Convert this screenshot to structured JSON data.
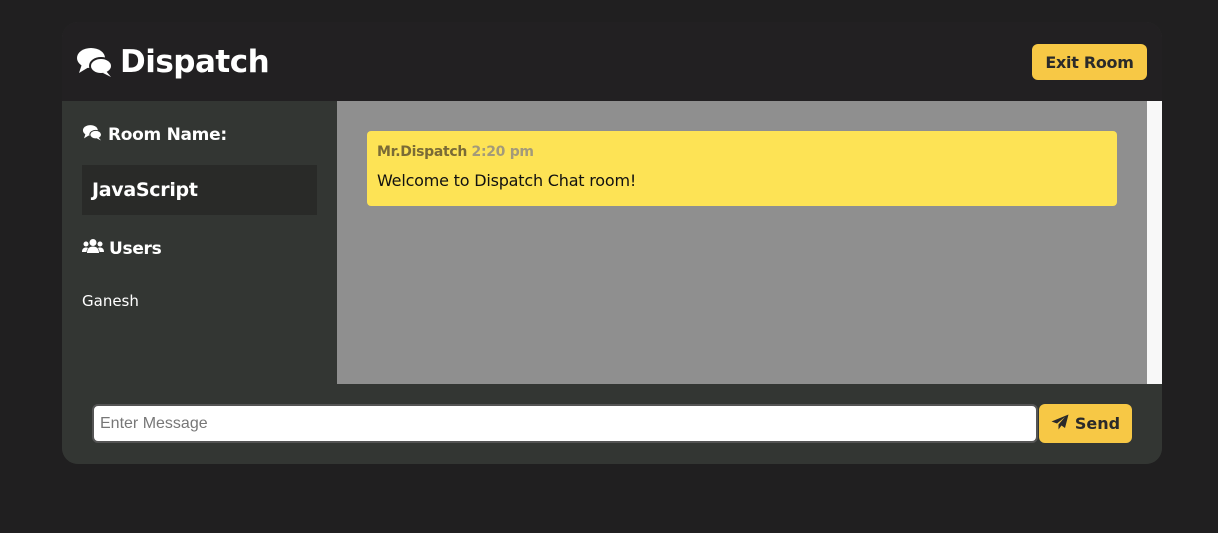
{
  "header": {
    "title": "Dispatch",
    "exit_label": "Exit Room"
  },
  "sidebar": {
    "room_heading": "Room Name:",
    "room_name": "JavaScript",
    "users_heading": "Users",
    "users": [
      "Ganesh"
    ]
  },
  "chat": {
    "messages": [
      {
        "author": "Mr.Dispatch",
        "time": "2:20 pm",
        "text": "Welcome to Dispatch Chat room!"
      }
    ]
  },
  "composer": {
    "placeholder": "Enter Message",
    "value": "",
    "send_label": "Send"
  },
  "colors": {
    "accent": "#f7c845",
    "message_bg": "#fde355",
    "background": "#201f20",
    "panel": "#333633"
  },
  "icons": {
    "brand": "comments-icon",
    "room": "comments-icon",
    "users": "users-icon",
    "send": "paper-plane-icon"
  }
}
